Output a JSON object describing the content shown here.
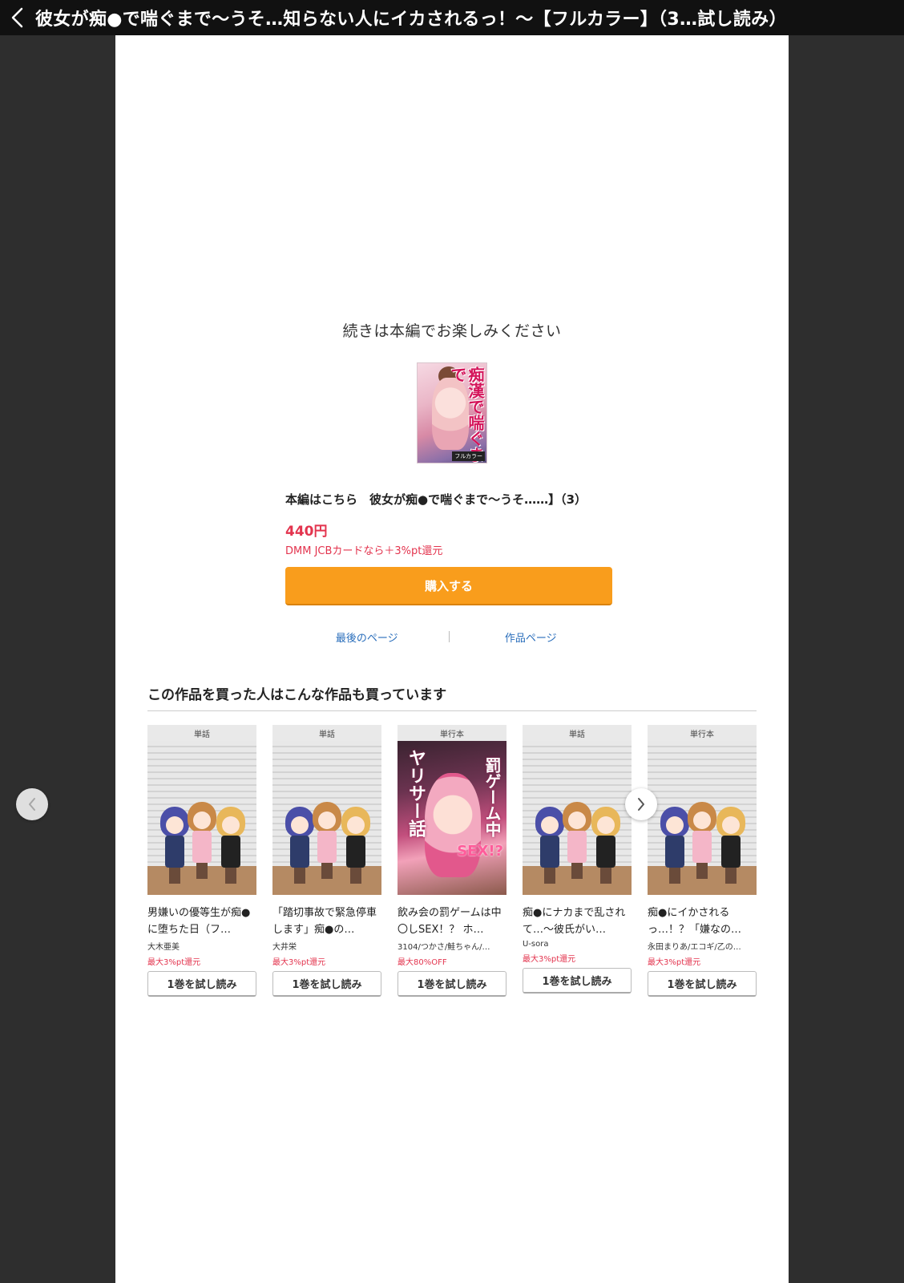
{
  "topbar": {
    "title": "彼女が痴●で喘ぐまで〜うそ…知らない人にイカされるっ！〜【フルカラー】（3…試し読み）"
  },
  "end_screen": {
    "continue_message": "続きは本編でお楽しみください",
    "cover_title": "痴漢で喘ぐまで",
    "cover_label": "フルカラー",
    "product_line": "本編はこちら　彼女が痴●で喘ぐまで〜うそ……】（3）",
    "price": "440円",
    "card_note": "DMM JCBカードなら＋3%pt還元",
    "buy_button": "購入する",
    "links": {
      "last_page": "最後のページ",
      "work_page": "作品ページ"
    }
  },
  "recommendations": {
    "heading": "この作品を買った人はこんな作品も買っています",
    "items": [
      {
        "badge": "単話",
        "title": "男嫌いの優等生が痴●に堕ちた日（フ…",
        "author": "大木亜美",
        "points": "最大3%pt還元",
        "button": "1巻を試し読み"
      },
      {
        "badge": "単話",
        "title": "「踏切事故で緊急停車します」痴●の…",
        "author": "大井栄",
        "points": "最大3%pt還元",
        "button": "1巻を試し読み"
      },
      {
        "badge": "単行本",
        "title": "飲み会の罰ゲームは中〇しSEX！？ ホ…",
        "author": "3104/つかさ/鮭ちゃん/…",
        "points": "最大80%OFF",
        "button": "1巻を試し読み",
        "cover_text_left": "ヤリサー話",
        "cover_text_right": "罰ゲーム中",
        "cover_text_badge": "SEX!?"
      },
      {
        "badge": "単話",
        "title": "痴●にナカまで乱されて…〜彼氏がい…",
        "author": "U-sora",
        "points": "最大3%pt還元",
        "button": "1巻を試し読み"
      },
      {
        "badge": "単行本",
        "title": "痴●にイかされるっ…！？「嫌なの…",
        "author": "永田まりあ/エコギ/乙の…",
        "points": "最大3%pt還元",
        "button": "1巻を試し読み"
      }
    ]
  },
  "colors": {
    "accent_orange": "#f99d1c",
    "price_red": "#e3344e",
    "link_blue": "#2a6ebb"
  }
}
